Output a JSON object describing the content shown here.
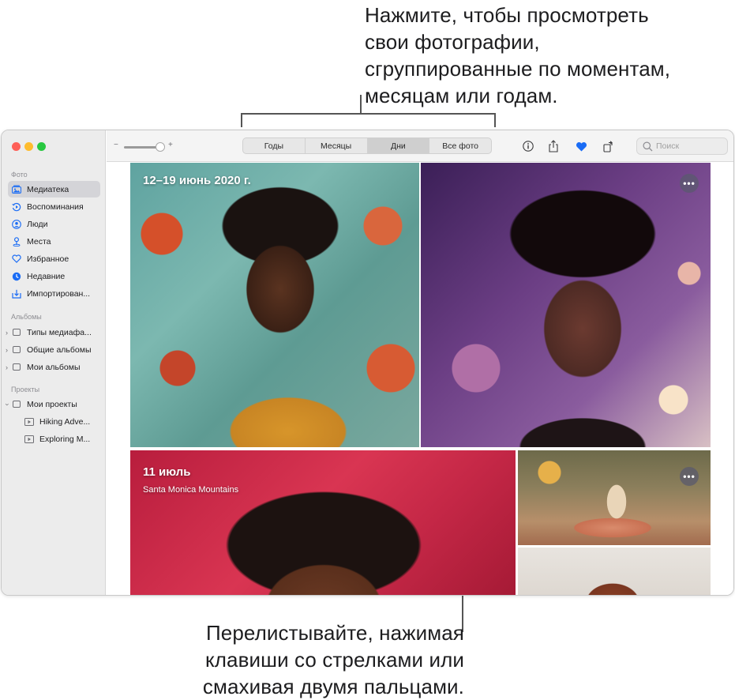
{
  "callouts": {
    "top_lines": [
      "Нажмите, чтобы просмотреть",
      "свои фотографии,",
      "сгруппированные по моментам,",
      "месяцам или годам."
    ],
    "bottom_lines": [
      "Перелистывайте, нажимая",
      "клавиши со стрелками или",
      "смахивая двумя пальцами."
    ]
  },
  "sidebar": {
    "section_photos": "Фото",
    "photos_items": [
      {
        "label": "Медиатека",
        "icon": "library-icon",
        "selected": true
      },
      {
        "label": "Воспоминания",
        "icon": "memories-icon"
      },
      {
        "label": "Люди",
        "icon": "people-icon"
      },
      {
        "label": "Места",
        "icon": "places-icon"
      },
      {
        "label": "Избранное",
        "icon": "heart-icon"
      },
      {
        "label": "Недавние",
        "icon": "clock-icon"
      },
      {
        "label": "Импортирован...",
        "icon": "import-icon"
      }
    ],
    "section_albums": "Альбомы",
    "album_items": [
      {
        "label": "Типы медиафа..."
      },
      {
        "label": "Общие альбомы"
      },
      {
        "label": "Мои альбомы"
      }
    ],
    "section_projects": "Проекты",
    "project_folder": "Мои проекты",
    "project_items": [
      {
        "label": "Hiking Adve..."
      },
      {
        "label": "Exploring M..."
      }
    ]
  },
  "toolbar": {
    "zoom_minus": "−",
    "zoom_plus": "+",
    "zoom_level": 0.8,
    "view_tabs": [
      "Годы",
      "Месяцы",
      "Дни",
      "Все фото"
    ],
    "active_tab": "Дни",
    "search_placeholder": "Поиск",
    "accent_color": "#1a6cf5"
  },
  "moments": [
    {
      "title": "12–19 июнь 2020 г.",
      "subtitle": ""
    },
    {
      "title": "11 июль",
      "subtitle": "Santa Monica Mountains"
    }
  ],
  "more_label": "•••"
}
